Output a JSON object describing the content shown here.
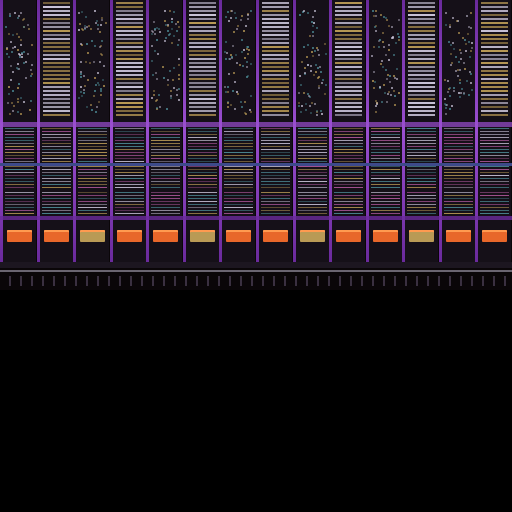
{
  "image": {
    "subject": "die micrograph",
    "colors": {
      "substrate": "#0a0608",
      "metal_strap": "#6a2a9c",
      "metal_strap_light": "#9a4fd0",
      "cell_dark": "#151018",
      "stripe_light": "#c9c3d8",
      "stripe_gold": "#b99a55",
      "stripe_teal": "#4e8f9a",
      "pad_orange": "#e8672a",
      "pad_orange_light": "#ff9a50",
      "band_blue": "#3d4a8a",
      "band_pink": "#b45aa0",
      "empty_region": "#000000"
    },
    "column_count": 14
  }
}
